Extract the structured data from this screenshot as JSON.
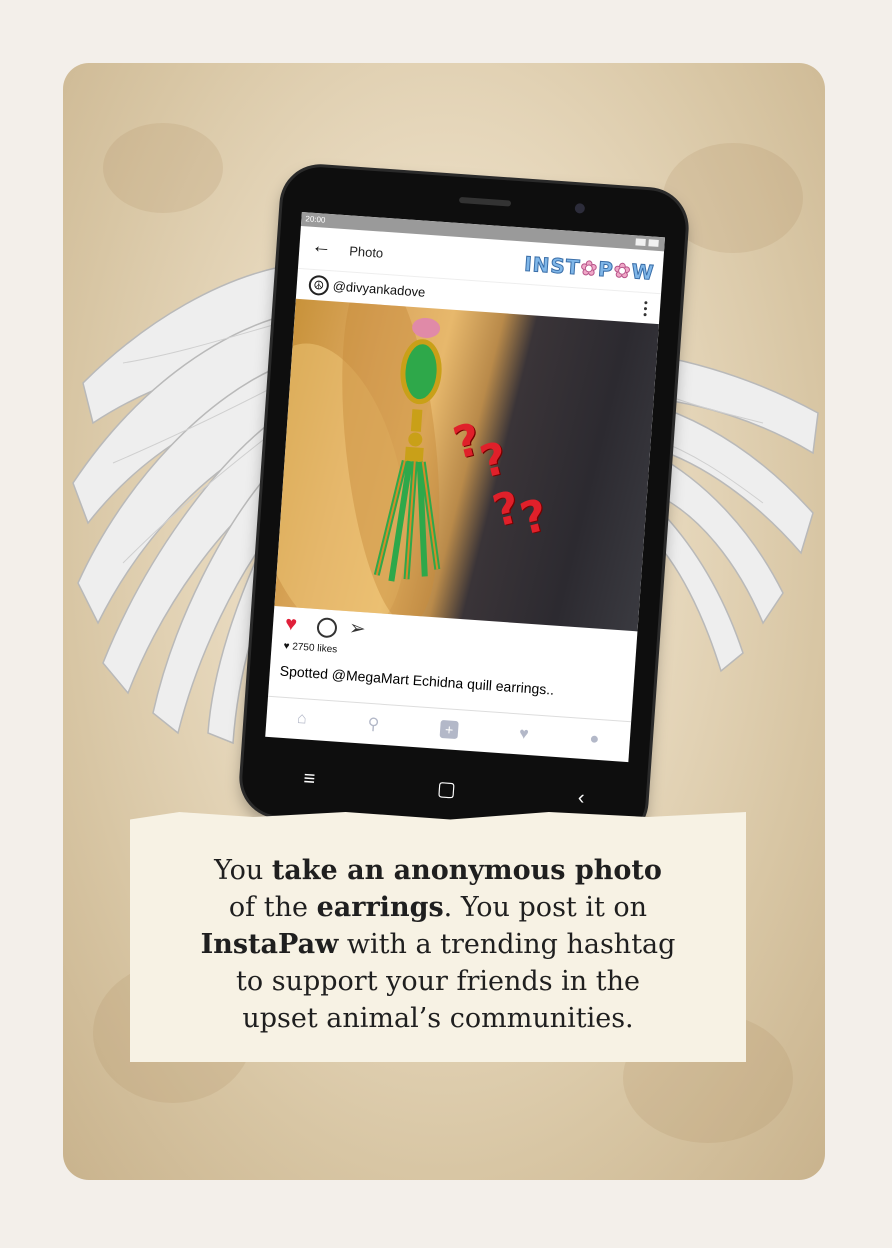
{
  "phone": {
    "status_time": "20:00",
    "topbar_title": "Photo",
    "logo_text_a": "INST",
    "logo_paw": "✿",
    "logo_text_b": "P",
    "logo_paw2": "✿",
    "logo_text_c": "W",
    "username": "@divyankadove",
    "likes": "2750 likes",
    "caption": "Spotted @MegaMart Echidna quill earrings..",
    "question_marks": [
      "?",
      "?",
      "?",
      "?"
    ]
  },
  "card_text": {
    "l1a": "You ",
    "l1b": "take an anonymous photo",
    "l2a": "of the ",
    "l2b": "earrings",
    "l2c": ". You post it on",
    "l3a": "InstaPaw",
    "l3b": " with a trending hashtag",
    "l4": "to support your friends in the",
    "l5": "upset animal’s communities."
  },
  "colors": {
    "accent_heart": "#e0203a",
    "question_marks": "#e0202a",
    "logo_blue": "#7fb6e8",
    "logo_pink": "#f0a8c8"
  },
  "icons": [
    "back-arrow-icon",
    "peace-icon",
    "more-icon",
    "heart-icon",
    "comment-icon",
    "share-icon",
    "home-icon",
    "search-icon",
    "add-icon",
    "activity-icon",
    "profile-icon",
    "menu-icon",
    "square-icon",
    "back-icon"
  ]
}
